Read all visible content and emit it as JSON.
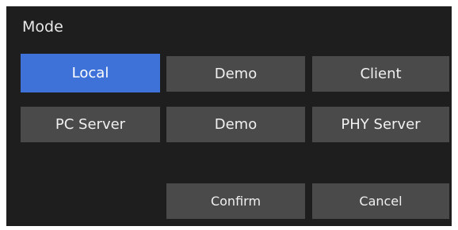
{
  "dialog": {
    "title": "Mode",
    "mode_buttons": [
      {
        "label": "Local",
        "selected": true
      },
      {
        "label": "Demo",
        "selected": false
      },
      {
        "label": "Client",
        "selected": false
      },
      {
        "label": "PC Server",
        "selected": false
      },
      {
        "label": "Demo",
        "selected": false
      },
      {
        "label": "PHY Server",
        "selected": false
      }
    ],
    "confirm_label": "Confirm",
    "cancel_label": "Cancel"
  },
  "colors": {
    "dialog_background": "#1e1e1e",
    "button_background": "#4a4a4a",
    "selected_background": "#3f72d8",
    "text": "#f0f0f0"
  }
}
